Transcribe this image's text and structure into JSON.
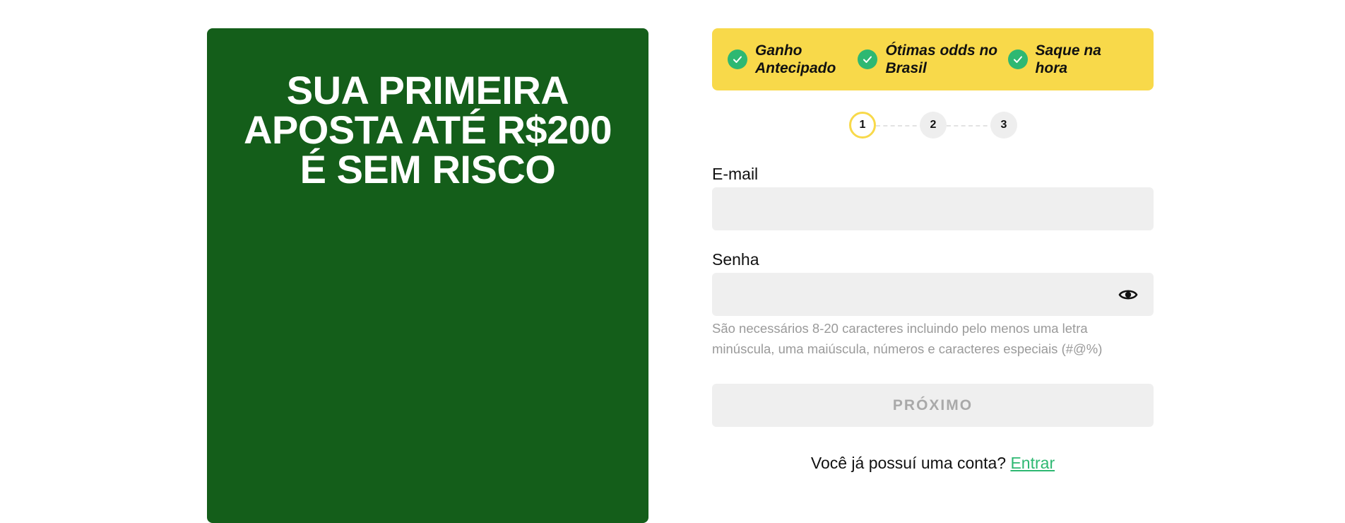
{
  "promo": {
    "headline": "SUA PRIMEIRA APOSTA ATÉ R$200 É SEM RISCO"
  },
  "benefits": [
    {
      "icon": "check-icon",
      "text_line1": "Ganho",
      "text_line2": "Antecipado"
    },
    {
      "icon": "check-icon",
      "text_line1": "Ótimas odds no",
      "text_line2": "Brasil"
    },
    {
      "icon": "check-icon",
      "text_line1": "Saque na",
      "text_line2": "hora"
    }
  ],
  "stepper": {
    "steps": [
      "1",
      "2",
      "3"
    ],
    "current_step": 1
  },
  "form": {
    "email_label": "E-mail",
    "email_value": "",
    "password_label": "Senha",
    "password_value": "",
    "password_toggle_icon": "eye-icon",
    "password_hint": "São necessários 8-20 caracteres incluindo pelo menos uma letra minúscula, uma maiúscula, números e caracteres especiais (#@%)",
    "next_button": "PRÓXIMO"
  },
  "login": {
    "prompt": "Você já possuí uma conta?",
    "link": "Entrar"
  },
  "colors": {
    "promo_bg": "#145e1a",
    "benefits_bg": "#f8d94a",
    "accent_green": "#2eb872",
    "input_bg": "#efefef"
  }
}
